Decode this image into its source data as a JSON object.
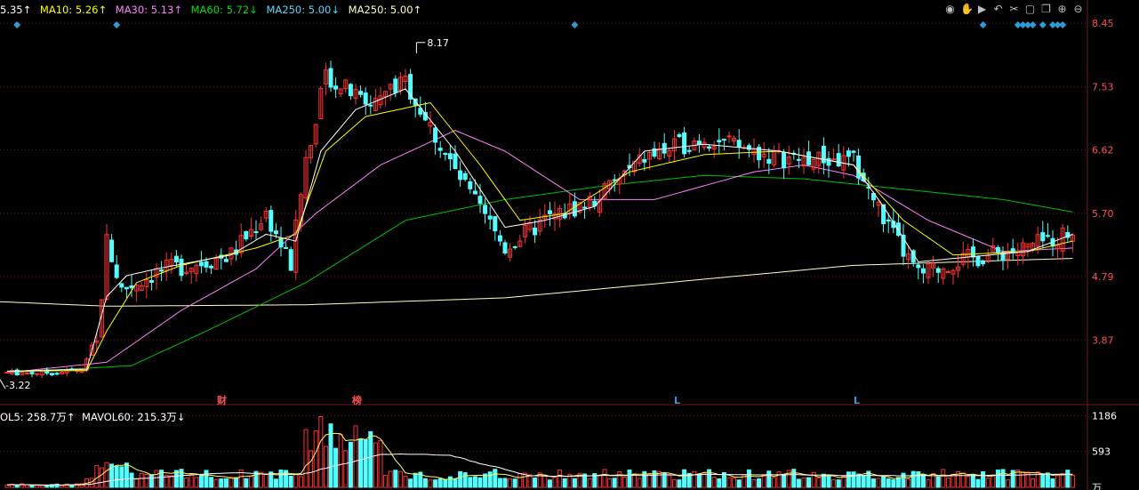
{
  "legend": {
    "ma5": "5.35↑",
    "ma10": "MA10: 5.26↑",
    "ma30": "MA30: 5.13↑",
    "ma60": "MA60: 5.72↓",
    "ma250a": "MA250: 5.00↓",
    "ma250b": "MA250: 5.00↑"
  },
  "volume_legend": {
    "vol5": "OL5: 258.7万↑",
    "mavol60": "MAVOL60: 215.3万↓"
  },
  "price_axis": [
    "8.45",
    "7.53",
    "6.62",
    "5.70",
    "4.79",
    "3.87"
  ],
  "volume_axis": [
    "1186",
    "593",
    "万"
  ],
  "annotations": {
    "high": "8.17",
    "low": "3.22",
    "marker1": "财",
    "marker2": "榜",
    "marker3": "L",
    "marker4": "L"
  },
  "colors": {
    "up": "#ff3232",
    "down": "#54ffff",
    "ma5": "#ffffff",
    "ma10": "#ffff00",
    "ma30": "#ff80ff",
    "ma60": "#00c000",
    "ma250": "#ffffc0",
    "grid": "#7a1414",
    "axis_text": "#ff5050"
  },
  "toolbar_icons": [
    "eye-icon",
    "hand-icon",
    "play-icon",
    "undo-icon",
    "scissors-icon",
    "lock-icon",
    "copy-icon",
    "zoom-in-icon",
    "zoom-out-icon"
  ],
  "chart_data": {
    "type": "candlestick",
    "ylim": [
      3.22,
      8.45
    ],
    "anchors": [
      [
        0,
        3.4
      ],
      [
        10,
        3.4
      ],
      [
        15,
        3.45
      ],
      [
        18,
        3.8
      ],
      [
        20,
        5.3
      ],
      [
        23,
        4.6
      ],
      [
        30,
        4.85
      ],
      [
        45,
        5.1
      ],
      [
        52,
        5.7
      ],
      [
        57,
        4.95
      ],
      [
        60,
        6.5
      ],
      [
        64,
        7.7
      ],
      [
        72,
        7.3
      ],
      [
        80,
        7.6
      ],
      [
        90,
        6.3
      ],
      [
        100,
        5.2
      ],
      [
        108,
        5.6
      ],
      [
        118,
        5.9
      ],
      [
        128,
        6.5
      ],
      [
        140,
        6.8
      ],
      [
        155,
        6.5
      ],
      [
        170,
        6.45
      ],
      [
        177,
        5.5
      ],
      [
        183,
        4.8
      ],
      [
        190,
        5.0
      ],
      [
        205,
        5.2
      ],
      [
        214,
        5.45
      ]
    ],
    "ma_paths": {
      "ma5": [
        [
          0,
          3.42
        ],
        [
          16,
          3.45
        ],
        [
          20,
          4.5
        ],
        [
          24,
          4.8
        ],
        [
          30,
          4.9
        ],
        [
          45,
          5.1
        ],
        [
          52,
          5.4
        ],
        [
          58,
          5.3
        ],
        [
          63,
          6.6
        ],
        [
          70,
          7.2
        ],
        [
          80,
          7.5
        ],
        [
          90,
          6.6
        ],
        [
          100,
          5.5
        ],
        [
          108,
          5.6
        ],
        [
          118,
          5.8
        ],
        [
          128,
          6.6
        ],
        [
          140,
          6.7
        ],
        [
          155,
          6.6
        ],
        [
          170,
          6.4
        ],
        [
          176,
          5.8
        ],
        [
          183,
          5.0
        ],
        [
          190,
          5.05
        ],
        [
          205,
          5.15
        ],
        [
          214,
          5.4
        ]
      ],
      "ma10": [
        [
          0,
          3.42
        ],
        [
          16,
          3.43
        ],
        [
          20,
          4.0
        ],
        [
          26,
          4.7
        ],
        [
          35,
          4.95
        ],
        [
          50,
          5.2
        ],
        [
          58,
          5.4
        ],
        [
          64,
          6.6
        ],
        [
          72,
          7.1
        ],
        [
          85,
          7.3
        ],
        [
          95,
          6.4
        ],
        [
          103,
          5.6
        ],
        [
          112,
          5.7
        ],
        [
          125,
          6.3
        ],
        [
          140,
          6.55
        ],
        [
          155,
          6.6
        ],
        [
          170,
          6.4
        ],
        [
          180,
          5.6
        ],
        [
          190,
          5.1
        ],
        [
          205,
          5.15
        ],
        [
          214,
          5.3
        ]
      ],
      "ma30": [
        [
          0,
          3.4
        ],
        [
          20,
          3.55
        ],
        [
          35,
          4.3
        ],
        [
          50,
          4.9
        ],
        [
          62,
          5.7
        ],
        [
          75,
          6.4
        ],
        [
          90,
          6.9
        ],
        [
          100,
          6.6
        ],
        [
          115,
          5.9
        ],
        [
          130,
          5.9
        ],
        [
          150,
          6.3
        ],
        [
          160,
          6.4
        ],
        [
          170,
          6.25
        ],
        [
          185,
          5.6
        ],
        [
          200,
          5.15
        ],
        [
          214,
          5.2
        ]
      ],
      "ma60": [
        [
          0,
          3.4
        ],
        [
          25,
          3.5
        ],
        [
          40,
          4.0
        ],
        [
          60,
          4.7
        ],
        [
          80,
          5.6
        ],
        [
          100,
          5.9
        ],
        [
          120,
          6.1
        ],
        [
          140,
          6.25
        ],
        [
          160,
          6.2
        ],
        [
          180,
          6.05
        ],
        [
          200,
          5.9
        ],
        [
          214,
          5.72
        ]
      ],
      "ma250": [
        [
          -20,
          4.47
        ],
        [
          0,
          4.42
        ],
        [
          20,
          4.36
        ],
        [
          60,
          4.38
        ],
        [
          100,
          4.48
        ],
        [
          140,
          4.75
        ],
        [
          170,
          4.95
        ],
        [
          200,
          5.02
        ],
        [
          214,
          5.05
        ]
      ]
    },
    "volume_ylim": [
      0,
      1250
    ]
  }
}
